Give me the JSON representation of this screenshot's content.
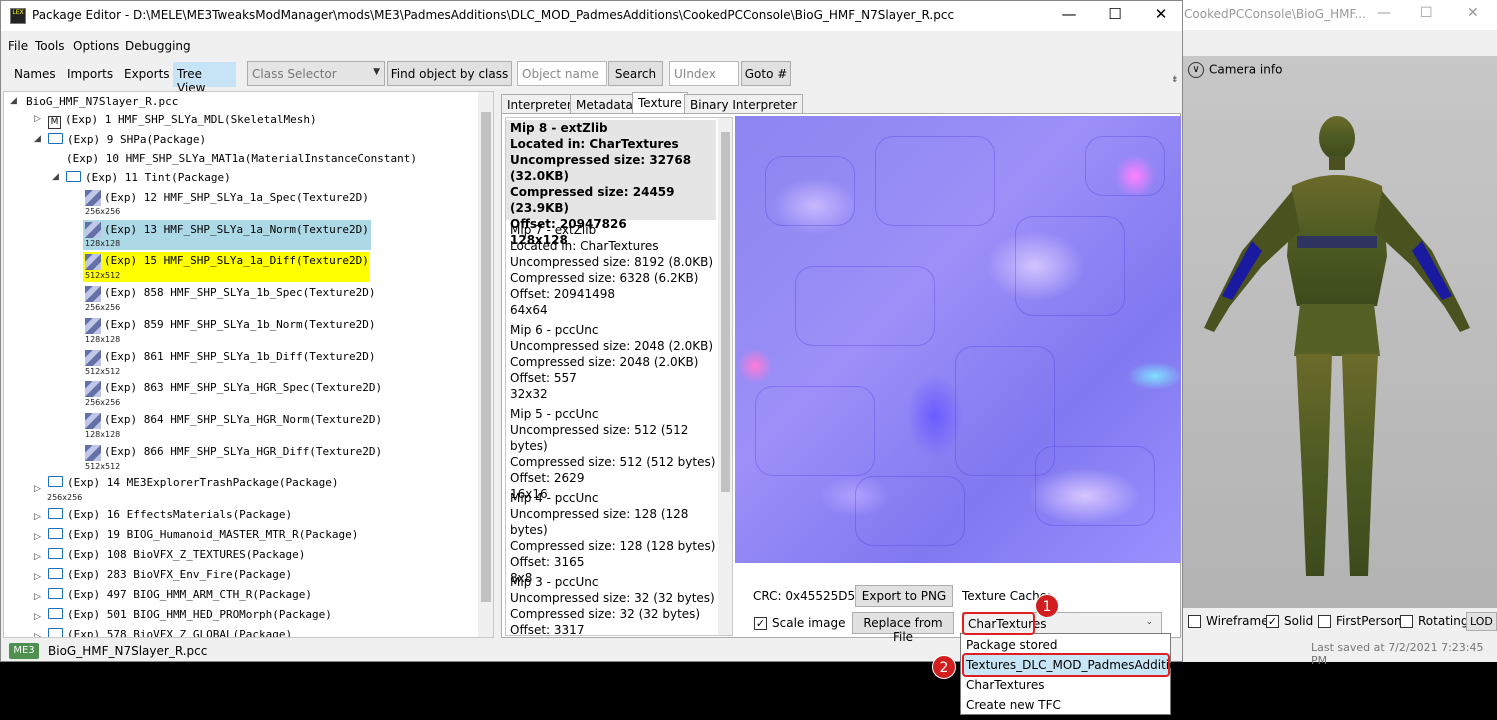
{
  "bg_window": {
    "title": "CookedPCConsole\\BioG_HMF...",
    "camera_info": "Camera info",
    "wireframe": "Wireframe",
    "solid": "Solid",
    "first_person": "FirstPerson",
    "rotating": "Rotating",
    "lod": "LOD",
    "last_saved": "Last saved at 7/2/2021 7:23:45 PM"
  },
  "window": {
    "title": "Package Editor - D:\\MELE\\ME3TweaksModManager\\mods\\ME3\\PadmesAdditions\\DLC_MOD_PadmesAdditions\\CookedPCConsole\\BioG_HMF_N7Slayer_R.pcc",
    "icon_text": "LEX"
  },
  "menu": [
    "File",
    "Tools",
    "Options",
    "Debugging"
  ],
  "toolbar": {
    "names": "Names",
    "imports": "Imports",
    "exports": "Exports",
    "tree_view": "Tree View",
    "class_selector": "Class Selector",
    "find_by_class": "Find object by class",
    "object_name_placeholder": "Object name",
    "search": "Search",
    "uindex_placeholder": "UIndex",
    "goto": "Goto #"
  },
  "tree": {
    "root": "BioG_HMF_N7Slayer_R.pcc",
    "n1": "(Exp) 1 HMF_SHP_SLYa_MDL(SkeletalMesh)",
    "n1_badge": "M",
    "n9": "(Exp) 9 SHPa(Package)",
    "n10": "(Exp) 10 HMF_SHP_SLYa_MAT1a(MaterialInstanceConstant)",
    "n11": "(Exp) 11 Tint(Package)",
    "t12": "(Exp) 12 HMF_SHP_SLYa_1a_Spec(Texture2D)",
    "t12_size": "256x256",
    "t13": "(Exp) 13 HMF_SHP_SLYa_1a_Norm(Texture2D)",
    "t13_size": "128x128",
    "t15": "(Exp) 15 HMF_SHP_SLYa_1a_Diff(Texture2D)",
    "t15_size": "512x512",
    "t858": "(Exp) 858 HMF_SHP_SLYa_1b_Spec(Texture2D)",
    "t858_size": "256x256",
    "t859": "(Exp) 859 HMF_SHP_SLYa_1b_Norm(Texture2D)",
    "t859_size": "128x128",
    "t861": "(Exp) 861 HMF_SHP_SLYa_1b_Diff(Texture2D)",
    "t861_size": "512x512",
    "t863": "(Exp) 863 HMF_SHP_SLYa_HGR_Spec(Texture2D)",
    "t863_size": "256x256",
    "t864": "(Exp) 864 HMF_SHP_SLYa_HGR_Norm(Texture2D)",
    "t864_size": "128x128",
    "t866": "(Exp) 866 HMF_SHP_SLYa_HGR_Diff(Texture2D)",
    "t866_size": "512x512",
    "n14": "(Exp) 14 ME3ExplorerTrashPackage(Package)",
    "n14_size": "256x256",
    "n16": "(Exp) 16 EffectsMaterials(Package)",
    "n19": "(Exp) 19 BIOG_Humanoid_MASTER_MTR_R(Package)",
    "n108": "(Exp) 108 BioVFX_Z_TEXTURES(Package)",
    "n283": "(Exp) 283 BioVFX_Env_Fire(Package)",
    "n497": "(Exp) 497 BIOG_HMM_ARM_CTH_R(Package)",
    "n501": "(Exp) 501 BIOG_HMM_HED_PROMorph(Package)",
    "n578": "(Exp) 578 BioVFX_Z_GLOBAL(Package)"
  },
  "tabs": [
    "Interpreter",
    "Metadata",
    "Texture",
    "Binary Interpreter"
  ],
  "mips": [
    {
      "l1": "Mip 8 - extZlib",
      "l2": "Located in: CharTextures",
      "l3": "Uncompressed size: 32768 (32.0KB)",
      "l4": "Compressed size: 24459 (23.9KB)",
      "l5": "Offset: 20947826",
      "l6": "128x128"
    },
    {
      "l1": "Mip 7 - extZlib",
      "l2": "Located in: CharTextures",
      "l3": "Uncompressed size: 8192 (8.0KB)",
      "l4": "Compressed size: 6328 (6.2KB)",
      "l5": "Offset: 20941498",
      "l6": "64x64"
    },
    {
      "l1": "Mip 6 - pccUnc",
      "l3": "Uncompressed size: 2048 (2.0KB)",
      "l4": "Compressed size: 2048 (2.0KB)",
      "l5": "Offset: 557",
      "l6": "32x32"
    },
    {
      "l1": "Mip 5 - pccUnc",
      "l3": "Uncompressed size: 512 (512 bytes)",
      "l4": "Compressed size: 512 (512 bytes)",
      "l5": "Offset: 2629",
      "l6": "16x16"
    },
    {
      "l1": "Mip 4 - pccUnc",
      "l3": "Uncompressed size: 128 (128 bytes)",
      "l4": "Compressed size: 128 (128 bytes)",
      "l5": "Offset: 3165",
      "l6": "8x8"
    },
    {
      "l1": "Mip 3 - pccUnc",
      "l3": "Uncompressed size: 32 (32 bytes)",
      "l4": "Compressed size: 32 (32 bytes)",
      "l5": "Offset: 3317"
    }
  ],
  "texture_panel": {
    "crc": "CRC: 0x45525D57",
    "export_png": "Export to PNG",
    "texture_cache_label": "Texture Cache:",
    "scale_image": "Scale image",
    "replace_from_file": "Replace from File",
    "cache_value": "CharTextures"
  },
  "dropdown_options": [
    "Package stored",
    "Textures_DLC_MOD_PadmesAdditions",
    "CharTextures",
    "Create new TFC"
  ],
  "annotations": {
    "badge1": "1",
    "badge2": "2"
  },
  "statusbar": {
    "game": "ME3",
    "file": "BioG_HMF_N7Slayer_R.pcc"
  },
  "colors": {
    "tree_selected": "#add8e6",
    "tree_highlight": "#ffff00",
    "annotation_red": "#e02020",
    "dropdown_hover": "#c8e6f5"
  }
}
